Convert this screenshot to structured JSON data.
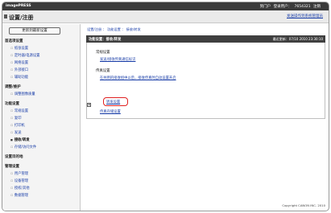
{
  "topbar": {
    "brand": "imagePRESS",
    "links": [
      "到门户",
      "登录用户：",
      "7654321",
      "注销"
    ]
  },
  "header": {
    "title": "设置/注册",
    "admin_link": "发送操作到系统管理员"
  },
  "sidebar": {
    "refresh_label": "更新到最新设置",
    "sections": [
      {
        "title": "首选项设置",
        "items": [
          "纸张设置",
          "定时器/电源设置",
          "网络设置",
          "外部接口",
          "辅助功能"
        ]
      },
      {
        "title": "调整/维护",
        "items": [
          "调整图像质量"
        ]
      },
      {
        "title": "功能设置",
        "items": [
          "常规设置",
          "复印",
          "打印机",
          "发送",
          "接收/转发",
          "存储/访问文件"
        ]
      },
      {
        "title": "设置目的地",
        "items": []
      },
      {
        "title": "管理设置",
        "items": [
          "用户管理",
          "设备管理",
          "授权/其他",
          "数据管理"
        ]
      }
    ],
    "selected": "接收/转发"
  },
  "content": {
    "breadcrumb": "设置/注册 ： 功能设置 ： 接收/转发",
    "title": "功能设置：接收/转发",
    "last_update": "最近更新：07/10 2010 23:30:10",
    "groups": [
      {
        "title": "常规设置",
        "links": [
          "发送/接收传真通信标识"
        ]
      },
      {
        "title": "传真设置",
        "links": [
          "在共用的接收组中以后，接收传真时自动设置开启",
          "转发设置",
          "传真存储设置"
        ]
      }
    ]
  },
  "footer": {
    "copyright": "Copyright CANON INC. 2010"
  }
}
